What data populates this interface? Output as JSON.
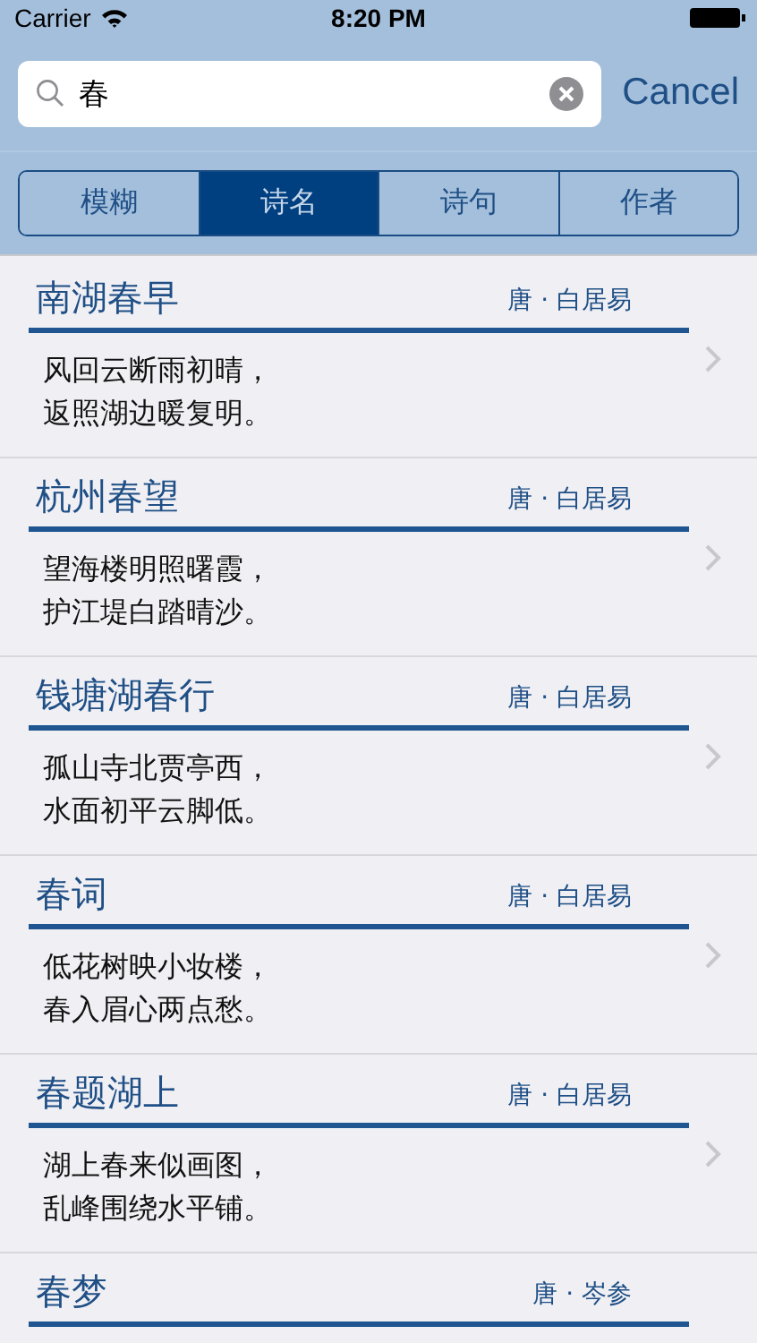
{
  "status_bar": {
    "carrier": "Carrier",
    "time": "8:20 PM"
  },
  "search": {
    "value": "春",
    "cancel": "Cancel"
  },
  "tabs": [
    {
      "label": "模糊",
      "selected": false
    },
    {
      "label": "诗名",
      "selected": true
    },
    {
      "label": "诗句",
      "selected": false
    },
    {
      "label": "作者",
      "selected": false
    }
  ],
  "poems": [
    {
      "title": "南湖春早",
      "author": "唐 · 白居易",
      "lines": [
        "风回云断雨初晴，",
        "返照湖边暖复明。"
      ]
    },
    {
      "title": "杭州春望",
      "author": "唐 · 白居易",
      "lines": [
        "望海楼明照曙霞，",
        "护江堤白踏晴沙。"
      ]
    },
    {
      "title": "钱塘湖春行",
      "author": "唐 · 白居易",
      "lines": [
        "孤山寺北贾亭西，",
        "水面初平云脚低。"
      ]
    },
    {
      "title": "春词",
      "author": "唐 · 白居易",
      "lines": [
        "低花树映小妆楼，",
        "春入眉心两点愁。"
      ]
    },
    {
      "title": "春题湖上",
      "author": "唐 · 白居易",
      "lines": [
        "湖上春来似画图，",
        "乱峰围绕水平铺。"
      ]
    },
    {
      "title": "春梦",
      "author": "唐 · 岑参"
    }
  ]
}
